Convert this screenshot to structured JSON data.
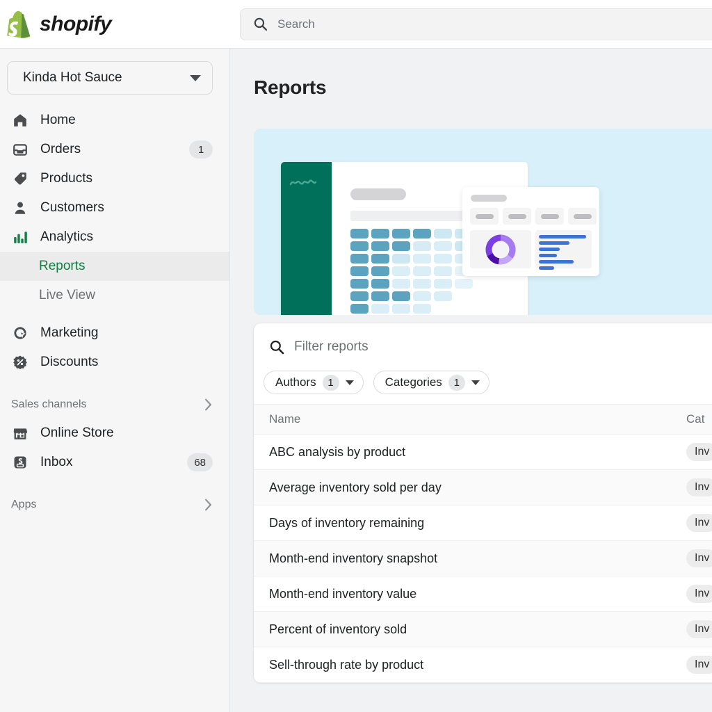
{
  "brand": {
    "word": "shopify",
    "logo_icon": "shopify-bag-icon",
    "logo_color": "#95BF47"
  },
  "search": {
    "placeholder": "Search",
    "icon": "search-icon"
  },
  "store_selector": {
    "name": "Kinda Hot Sauce",
    "icon": "chevron-down-icon"
  },
  "sidebar": {
    "items": [
      {
        "label": "Home",
        "icon": "home-icon",
        "badge": ""
      },
      {
        "label": "Orders",
        "icon": "orders-inbox-icon",
        "badge": "1"
      },
      {
        "label": "Products",
        "icon": "product-tag-icon",
        "badge": ""
      },
      {
        "label": "Customers",
        "icon": "customer-person-icon",
        "badge": ""
      },
      {
        "label": "Analytics",
        "icon": "analytics-bars-icon",
        "badge": ""
      }
    ],
    "sub_items": [
      {
        "label": "Reports",
        "active": true
      },
      {
        "label": "Live View",
        "active": false
      }
    ],
    "items2": [
      {
        "label": "Marketing",
        "icon": "marketing-target-icon",
        "badge": ""
      },
      {
        "label": "Discounts",
        "icon": "discount-percent-icon",
        "badge": ""
      }
    ],
    "sales_channels": {
      "label": "Sales channels",
      "icon": "chevron-right-icon"
    },
    "channel_items": [
      {
        "label": "Online Store",
        "icon": "storefront-icon",
        "badge": ""
      },
      {
        "label": "Inbox",
        "icon": "inbox-app-icon",
        "badge": "68"
      }
    ],
    "apps": {
      "label": "Apps",
      "icon": "chevron-right-icon"
    },
    "accent_green": "#108043"
  },
  "main": {
    "page_title": "Reports",
    "hero": {
      "background": "#D7F0F9",
      "panel_color": "#00705A",
      "heatmap_rows": [
        [
          "#5BA3BF",
          "#5BA3BF",
          "#5BA3BF",
          "#5BA3BF",
          "#CDE8F2",
          "#CDE8F2",
          "#CDE8F2",
          "#D9EEF6",
          "#E4F3F9"
        ],
        [
          "#5BA3BF",
          "#5BA3BF",
          "#5BA3BF",
          "#D6EBF4",
          "#D9EEF6",
          "#CDE8F2",
          "#D9EEF6",
          "#E4F3F9",
          "#EDF7FB"
        ],
        [
          "#5BA3BF",
          "#5BA3BF",
          "#CDE8F2",
          "#D9EEF6",
          "#D9EEF6",
          "#D9EEF6",
          "#E4F3F9",
          "#E4F3F9"
        ],
        [
          "#5BA3BF",
          "#5BA3BF",
          "#D9EEF6",
          "#D9EEF6",
          "#D9EEF6",
          "#E4F3F9",
          "#E4F3F9"
        ],
        [
          "#5BA3BF",
          "#5BA3BF",
          "#D9EEF6",
          "#D9EEF6",
          "#D9EEF6",
          "#E4F3F9"
        ],
        [
          "#5BA3BF",
          "#5BA3BF",
          "#5BA3BF",
          "#D9EEF6",
          "#D9EEF6"
        ],
        [
          "#5BA3BF",
          "#D9EEF6",
          "#D9EEF6",
          "#D9EEF6"
        ],
        [
          "#5BA3BF",
          "#5BA3BF",
          "#D9EEF6"
        ],
        [
          "#5BA3BF",
          "#CDE8F2"
        ],
        [
          "#5BA3BF"
        ]
      ],
      "overlay": {
        "stat_tiles": 4,
        "donut_colors": [
          "#4B0FA8",
          "#7B3FE4",
          "#A77BF0",
          "#C4A6F7"
        ],
        "bar_color": "#3D73D4",
        "bar_widths": [
          68,
          44,
          30,
          26,
          50,
          22
        ]
      }
    },
    "filter": {
      "placeholder": "Filter reports",
      "icon": "search-icon"
    },
    "filter_pills": [
      {
        "label": "Authors",
        "count": "1",
        "icon": "chevron-down-icon"
      },
      {
        "label": "Categories",
        "count": "1",
        "icon": "chevron-down-icon"
      }
    ],
    "table": {
      "columns": {
        "name": "Name",
        "category": "Cat"
      },
      "rows": [
        {
          "name": "ABC analysis by product",
          "category": "Inv"
        },
        {
          "name": "Average inventory sold per day",
          "category": "Inv"
        },
        {
          "name": "Days of inventory remaining",
          "category": "Inv"
        },
        {
          "name": "Month-end inventory snapshot",
          "category": "Inv"
        },
        {
          "name": "Month-end inventory value",
          "category": "Inv"
        },
        {
          "name": "Percent of inventory sold",
          "category": "Inv"
        },
        {
          "name": "Sell-through rate by product",
          "category": "Inv"
        }
      ]
    }
  }
}
